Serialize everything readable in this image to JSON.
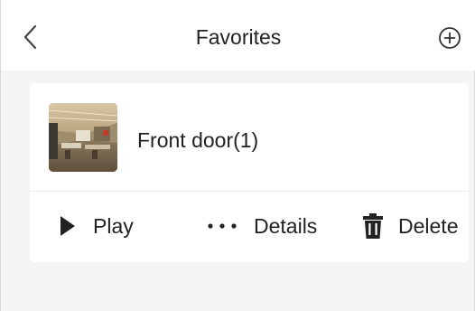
{
  "header": {
    "title": "Favorites",
    "back_icon": "chevron-left-icon",
    "add_icon": "plus-circle-icon"
  },
  "favorites": [
    {
      "name": "Front door(1)",
      "thumbnail": "camera-snapshot-office",
      "actions": {
        "play_label": "Play",
        "details_label": "Details",
        "delete_label": "Delete"
      }
    }
  ],
  "colors": {
    "background": "#f5f5f7",
    "card": "#ffffff",
    "text": "#222222"
  }
}
